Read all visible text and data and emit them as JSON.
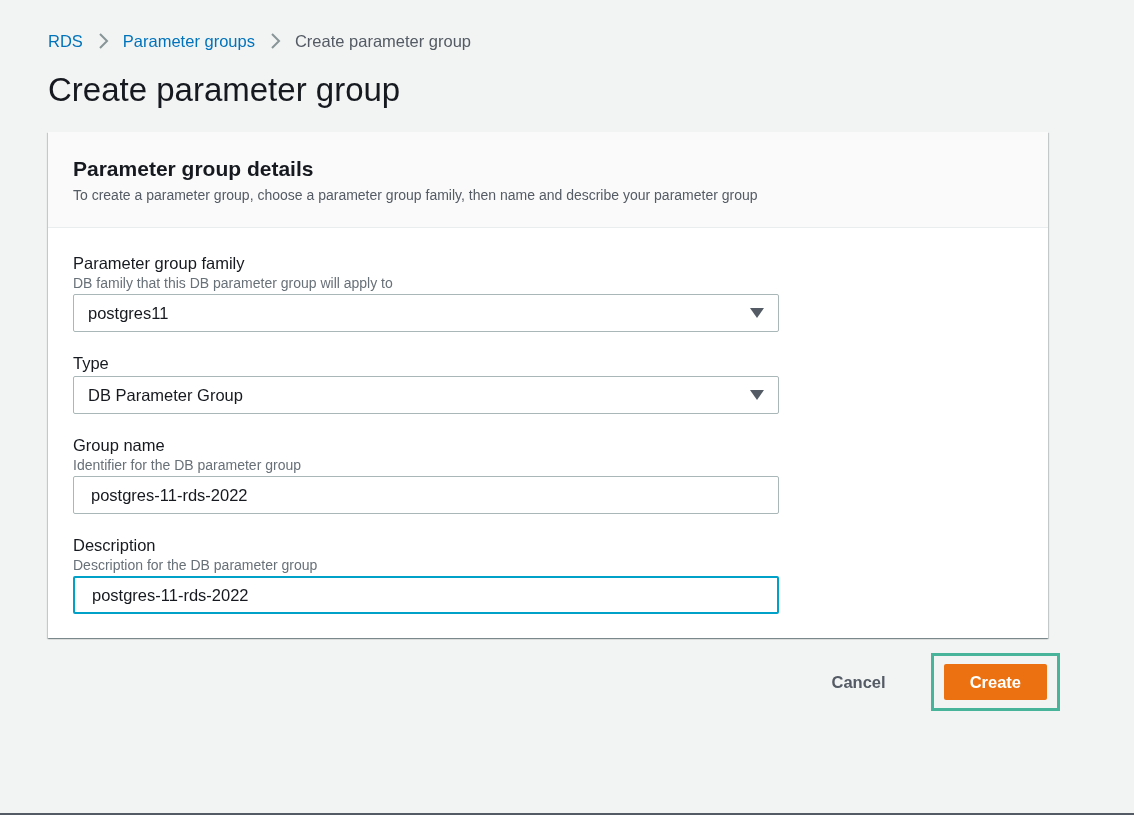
{
  "breadcrumbs": [
    {
      "label": "RDS",
      "kind": "link"
    },
    {
      "label": "Parameter groups",
      "kind": "link"
    },
    {
      "label": "Create parameter group",
      "kind": "current"
    }
  ],
  "page_title": "Create parameter group",
  "card": {
    "title": "Parameter group details",
    "description": "To create a parameter group, choose a parameter group family, then name and describe your parameter group",
    "fields": [
      {
        "kind": "select",
        "label": "Parameter group family",
        "hint": "DB family that this DB parameter group will apply to",
        "value": "postgres11",
        "focused": false
      },
      {
        "kind": "select",
        "label": "Type",
        "value": "DB Parameter Group",
        "focused": false
      },
      {
        "kind": "text",
        "label": "Group name",
        "hint": "Identifier for the DB parameter group",
        "value": "postgres-11-rds-2022",
        "focused": false
      },
      {
        "kind": "text",
        "label": "Description",
        "hint": "Description for the DB parameter group",
        "value": "postgres-11-rds-2022",
        "focused": true
      }
    ]
  },
  "actions": [
    {
      "label": "Cancel",
      "kind": "link",
      "highlighted": false
    },
    {
      "label": "Create",
      "kind": "primary",
      "highlighted": true
    }
  ]
}
